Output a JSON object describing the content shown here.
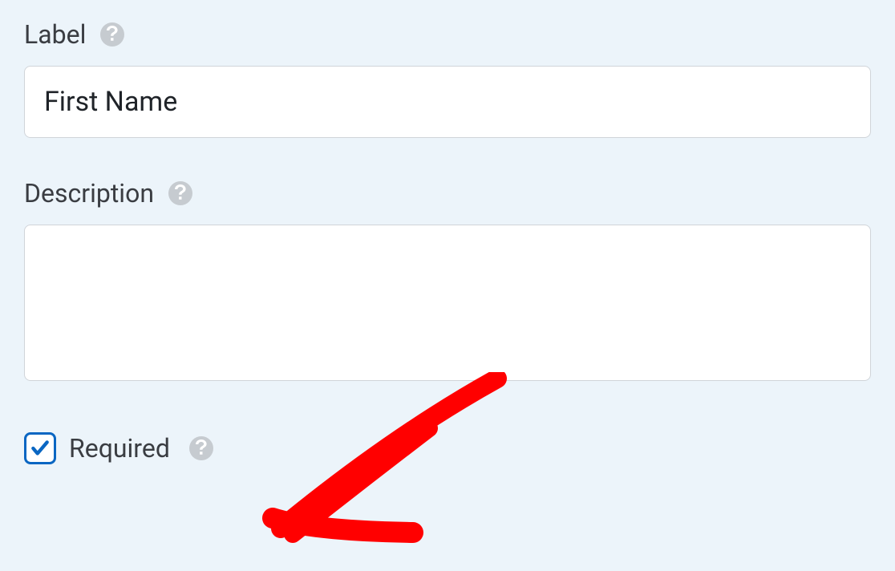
{
  "fields": {
    "label": {
      "title": "Label",
      "value": "First Name"
    },
    "description": {
      "title": "Description",
      "value": ""
    },
    "required": {
      "title": "Required",
      "checked": true
    }
  }
}
